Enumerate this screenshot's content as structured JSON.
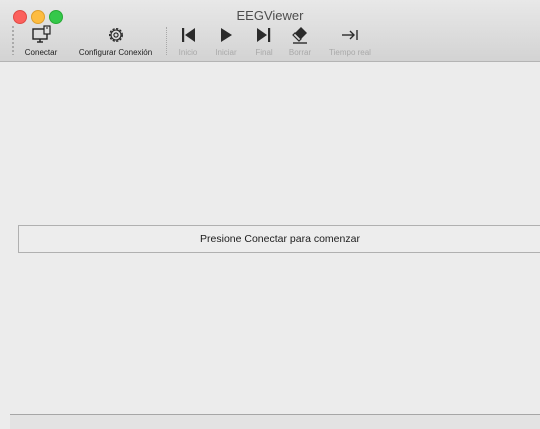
{
  "window": {
    "title": "EEGViewer"
  },
  "toolbar": {
    "items": [
      {
        "label": "Conectar",
        "icon": "monitor-connect-icon",
        "enabled": true
      },
      {
        "label": "Configurar Conexión",
        "icon": "gear-icon",
        "enabled": true
      },
      {
        "label": "Inicio",
        "icon": "skip-to-start-icon",
        "enabled": false
      },
      {
        "label": "Iniciar",
        "icon": "play-icon",
        "enabled": false
      },
      {
        "label": "Final",
        "icon": "skip-to-end-icon",
        "enabled": false
      },
      {
        "label": "Borrar",
        "icon": "eraser-icon",
        "enabled": false
      },
      {
        "label": "Tiempo real",
        "icon": "arrow-to-end-icon",
        "enabled": false
      }
    ]
  },
  "main": {
    "status_message": "Presione Conectar para comenzar"
  },
  "colors": {
    "enabled": "#1e1e1e",
    "disabled": "#a9a9a9",
    "close": "#fc605c",
    "minimize": "#fdbc40",
    "maximize": "#34c84a"
  }
}
